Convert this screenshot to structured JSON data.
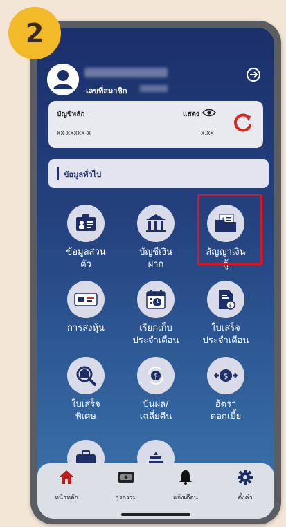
{
  "step_number": "2",
  "header": {
    "member_label": "เลขที่สมาชิก"
  },
  "account": {
    "title": "บัญชีหลัก",
    "show_label": "แสดง",
    "number": "xx-xxxxx-x",
    "amount": "x.xx"
  },
  "section": {
    "title": "ข้อมูลทั่วไป"
  },
  "menu": [
    {
      "label": "ข้อมูลส่วน\nตัว",
      "icon": "id-card-icon"
    },
    {
      "label": "บัญชีเงิน\nฝาก",
      "icon": "bank-icon"
    },
    {
      "label": "สัญญาเงิน\nกู้",
      "icon": "loan-folder-icon"
    },
    {
      "label": "การส่งหุ้น",
      "icon": "share-card-icon"
    },
    {
      "label": "เรียกเก็บ\nประจำเดือน",
      "icon": "monthly-billing-icon"
    },
    {
      "label": "ใบเสร็จ\nประจำเดือน",
      "icon": "monthly-receipt-icon"
    },
    {
      "label": "ใบเสร็จ\nพิเศษ",
      "icon": "special-receipt-icon"
    },
    {
      "label": "ปันผล/\nเฉลี่ยคืน",
      "icon": "dividend-icon"
    },
    {
      "label": "อัตรา\nดอกเบี้ย",
      "icon": "interest-rate-icon"
    }
  ],
  "bottom_nav": [
    {
      "label": "หน้าหลัก",
      "icon": "home-icon"
    },
    {
      "label": "ธุรกรรม",
      "icon": "transaction-icon"
    },
    {
      "label": "แจ้งเตือน",
      "icon": "bell-icon"
    },
    {
      "label": "ตั้งค่า",
      "icon": "gear-icon"
    }
  ],
  "colors": {
    "accent_badge": "#f2b928",
    "highlight_border": "#e0141c",
    "screen_top": "#1b2f6b",
    "refresh_icon": "#d42a1f",
    "home_icon": "#b8201c"
  }
}
